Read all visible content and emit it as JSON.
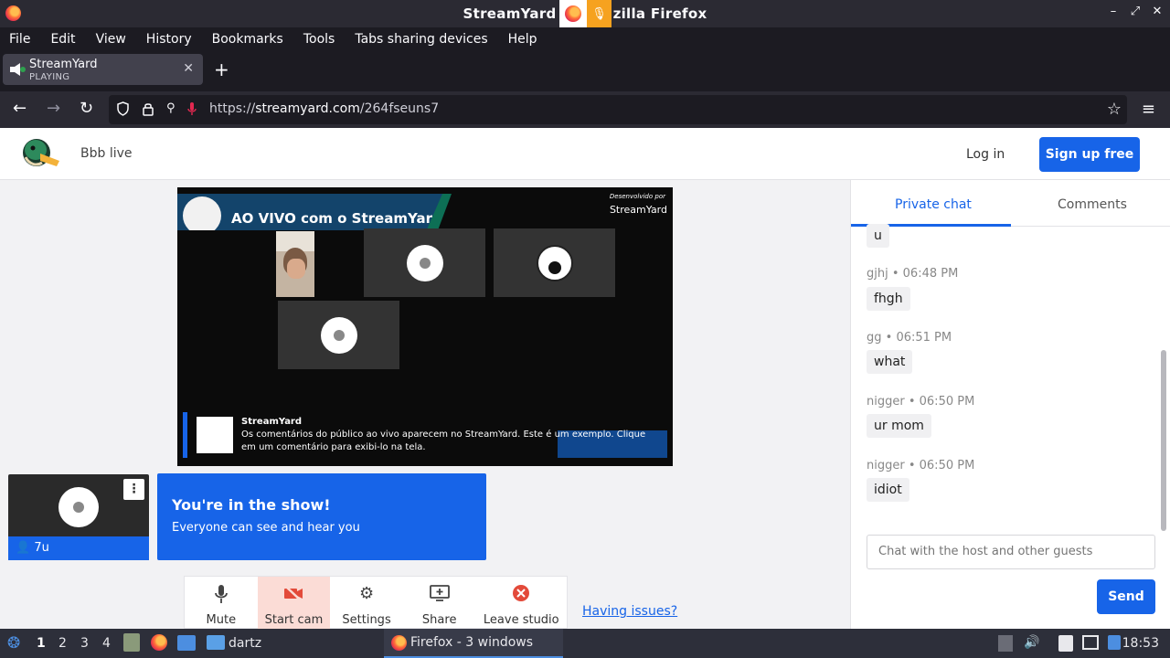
{
  "window": {
    "title": "StreamYard — Mozilla Firefox",
    "title_visible": "StreamYard",
    "title_suffix": "zilla Firefox",
    "controls": [
      "–",
      "⤢",
      "✕"
    ]
  },
  "menubar": [
    "File",
    "Edit",
    "View",
    "History",
    "Bookmarks",
    "Tools",
    "Tabs sharing devices",
    "Help"
  ],
  "tab": {
    "title": "StreamYard",
    "status": "PLAYING",
    "close": "✕",
    "new_tab": "+"
  },
  "navbar": {
    "url_prefix": "https://",
    "url_host": "streamyard.com",
    "url_path": "/264fseuns7"
  },
  "page": {
    "studio_name": "Bbb live",
    "login": "Log in",
    "signup": "Sign up free",
    "stage": {
      "banner_text": "AO VIVO com o StreamYard",
      "developed_by": "Desenvolvido por",
      "dev_brand": "StreamYard",
      "comment_name": "StreamYard",
      "comment_text": "Os comentários do público ao vivo aparecem no StreamYard. Este é um exemplo. Clique em um comentário para exibi-lo na tela."
    },
    "self_tile": {
      "name": "7u",
      "menu": "⋮"
    },
    "notice": {
      "title": "You're in the show!",
      "subtitle": "Everyone can see and hear you"
    },
    "toolbar": [
      {
        "label": "Mute",
        "icon": "microphone-icon"
      },
      {
        "label": "Start cam",
        "icon": "camera-off-icon"
      },
      {
        "label": "Settings",
        "icon": "gear-icon"
      },
      {
        "label": "Share",
        "icon": "screen-share-icon"
      },
      {
        "label": "Leave studio",
        "icon": "leave-icon"
      }
    ],
    "having_issues": "Having issues?"
  },
  "chat": {
    "tabs": [
      "Private chat",
      "Comments"
    ],
    "messages": [
      {
        "author": "",
        "time": "",
        "text": "u"
      },
      {
        "author": "gjhj",
        "time": "06:48 PM",
        "text": "fhgh"
      },
      {
        "author": "gg",
        "time": "06:51 PM",
        "text": "what"
      },
      {
        "author": "nigger",
        "time": "06:50 PM",
        "text": "ur mom"
      },
      {
        "author": "nigger",
        "time": "06:50 PM",
        "text": "idiot"
      }
    ],
    "placeholder": "Chat with the host and other guests",
    "send": "Send"
  },
  "taskbar": {
    "workspaces": [
      "1",
      "2",
      "3",
      "4"
    ],
    "folder": "dartz",
    "active_window": "Firefox - 3 windows",
    "clock": "18:53"
  }
}
